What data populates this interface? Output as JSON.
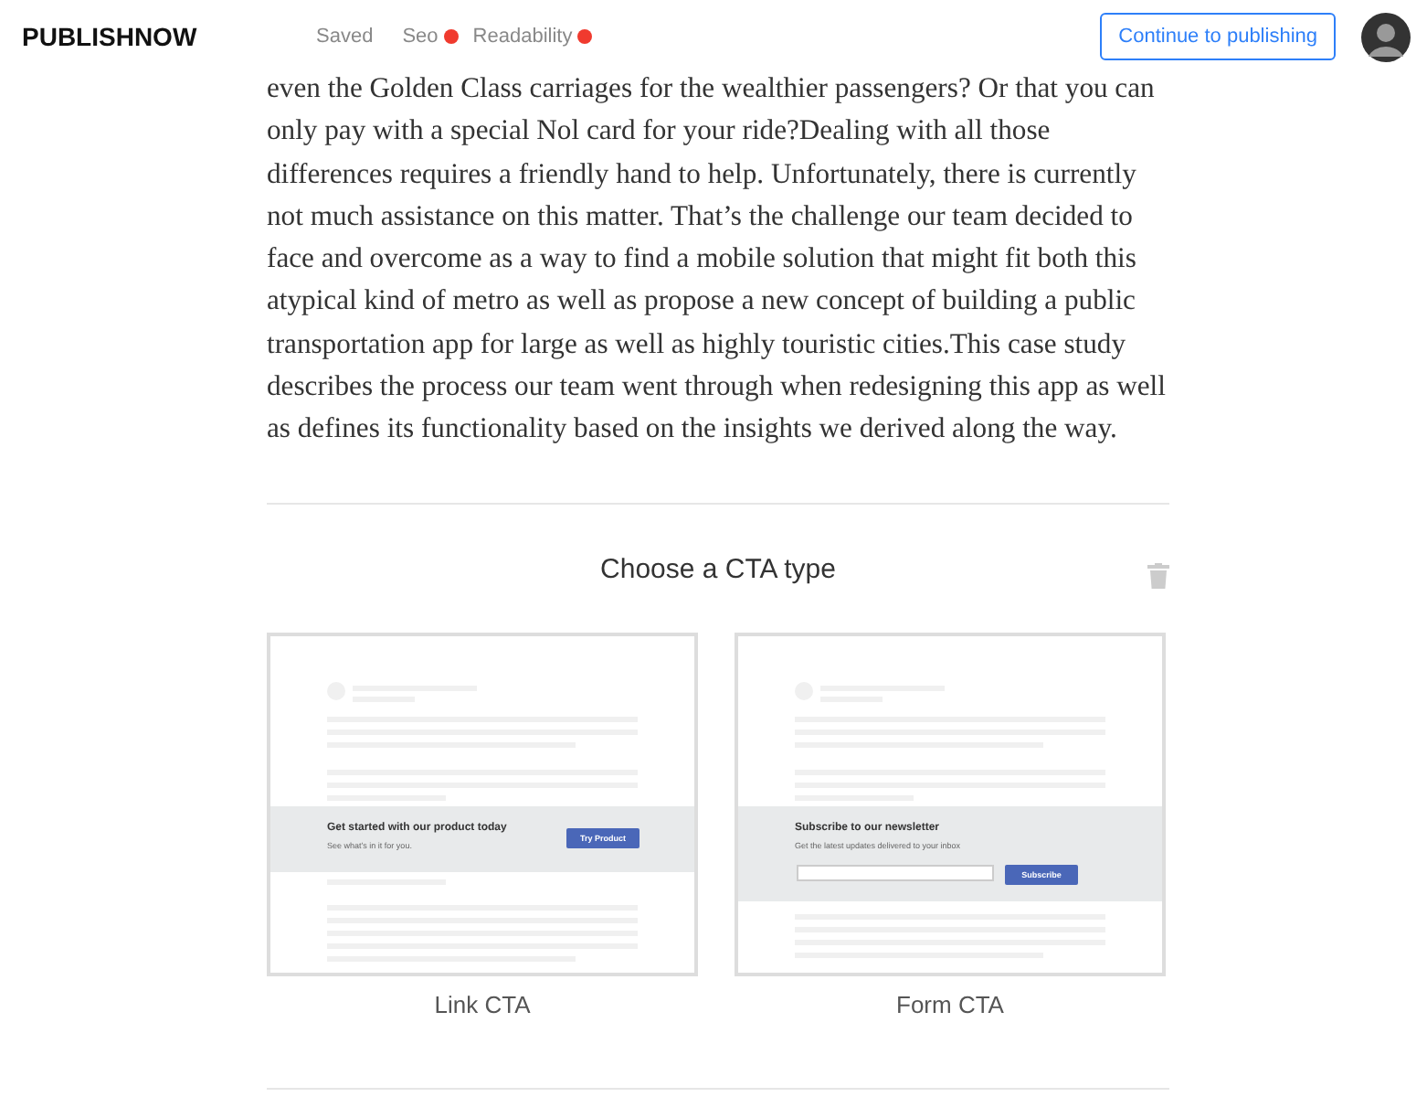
{
  "header": {
    "logo": "PUBLISHNOW",
    "save_status": "Saved",
    "checks": [
      {
        "label": "Seo",
        "color": "#f03a2e"
      },
      {
        "label": "Readability",
        "color": "#f03a2e"
      }
    ],
    "publish_button": "Continue to publishing"
  },
  "article": {
    "text": "even the Golden Class carriages for the wealthier passengers? Or that you can only pay with a special Nol card for your ride?Dealing with all those differences requires a friendly hand to help. Unfortunately, there is currently not much assistance on this matter. That’s the challenge our team decided to face and overcome as a way to find a mobile solution that might fit both this atypical kind of metro as well as propose a new concept of building a public transportation app for large as well as highly touristic cities.This case study describes the process our team went through when redesigning this app as well as defines its functionality based on the insights we derived along the way."
  },
  "cta_picker": {
    "title": "Choose a CTA type",
    "options": [
      {
        "kind": "link",
        "label": "Link CTA",
        "heading": "Get started with our product today",
        "subtext": "See what’s in it for you.",
        "button": "Try Product"
      },
      {
        "kind": "form",
        "label": "Form CTA",
        "heading": "Subscribe to our newsletter",
        "subtext": "Get the latest updates delivered to your inbox",
        "button": "Subscribe"
      }
    ]
  }
}
